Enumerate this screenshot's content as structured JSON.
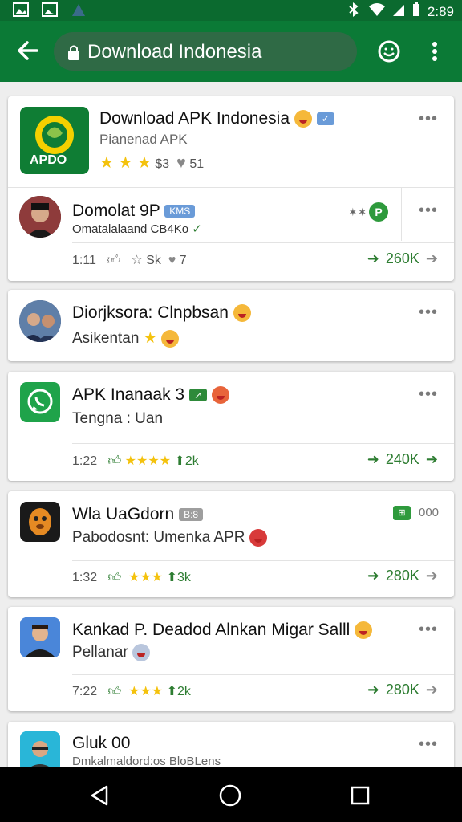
{
  "status_bar": {
    "time": "2:89"
  },
  "toolbar": {
    "search_text": "Download Indonesia"
  },
  "cards": [
    {
      "title": "Download APK Indonesia",
      "subtitle": "Pianenad APK",
      "rating": "$3",
      "likes": "51",
      "icon_text": "APDO"
    },
    {
      "title": "Domolat 9P",
      "badge": "KMS",
      "subtitle": "Omatalalaand CB4Ko",
      "time": "1:11",
      "views": "Sk",
      "likes": "7",
      "downloads": "260K"
    },
    {
      "title": "Diorjksora: Clnpbsan",
      "subtitle": "Asikentan"
    },
    {
      "title": "APK Inanaak 3",
      "subtitle": "Tengna : Uan",
      "time": "1:22",
      "count": "2k",
      "downloads": "240K"
    },
    {
      "title": "Wla UaGdorn",
      "badge": "B:8",
      "subtitle": "Pabodosnt: Umenka APR",
      "right_label": "000",
      "time": "1:32",
      "count": "3k",
      "downloads": "280K"
    },
    {
      "title": "Kankad P. Deadod Alnkan Migar Salll",
      "subtitle": "Pellanar",
      "time": "7:22",
      "count": "2k",
      "downloads": "280K"
    },
    {
      "title": "Gluk 00",
      "subtitle": "Dmkalmaldord:os BloBLens"
    }
  ],
  "colors": {
    "toolbar": "#0b7a36",
    "status_bar": "#0b6a2f",
    "accent_green": "#2e7d32",
    "star": "#f4c20d"
  }
}
